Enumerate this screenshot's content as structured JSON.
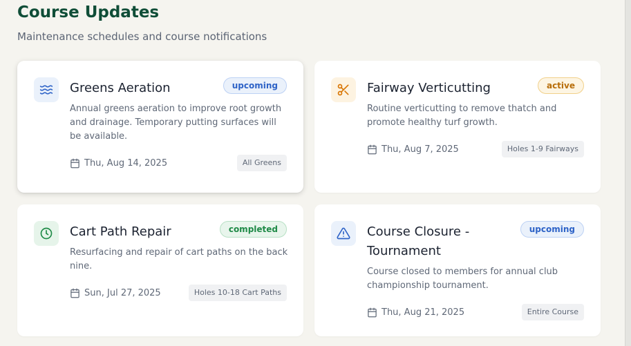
{
  "header": {
    "title": "Course Updates",
    "subtitle": "Maintenance schedules and course notifications"
  },
  "colors": {
    "title": "#0f4d37",
    "upcoming": "#2e63c7",
    "active": "#b86e0a",
    "completed": "#1f8a47"
  },
  "cards": [
    {
      "icon": "waves-icon",
      "title": "Greens Aeration",
      "status": "upcoming",
      "description": "Annual greens aeration to improve root growth and drainage. Temporary putting surfaces will be available.",
      "date": "Thu, Aug 14, 2025",
      "location": "All Greens"
    },
    {
      "icon": "scissors-icon",
      "title": "Fairway Verticutting",
      "status": "active",
      "description": "Routine verticutting to remove thatch and promote healthy turf growth.",
      "date": "Thu, Aug 7, 2025",
      "location": "Holes 1-9 Fairways"
    },
    {
      "icon": "clock-icon",
      "title": "Cart Path Repair",
      "status": "completed",
      "description": "Resurfacing and repair of cart paths on the back nine.",
      "date": "Sun, Jul 27, 2025",
      "location": "Holes 10-18 Cart Paths"
    },
    {
      "icon": "alert-triangle-icon",
      "title": "Course Closure - Tournament",
      "status": "upcoming",
      "description": "Course closed to members for annual club championship tournament.",
      "date": "Thu, Aug 21, 2025",
      "location": "Entire Course"
    }
  ]
}
